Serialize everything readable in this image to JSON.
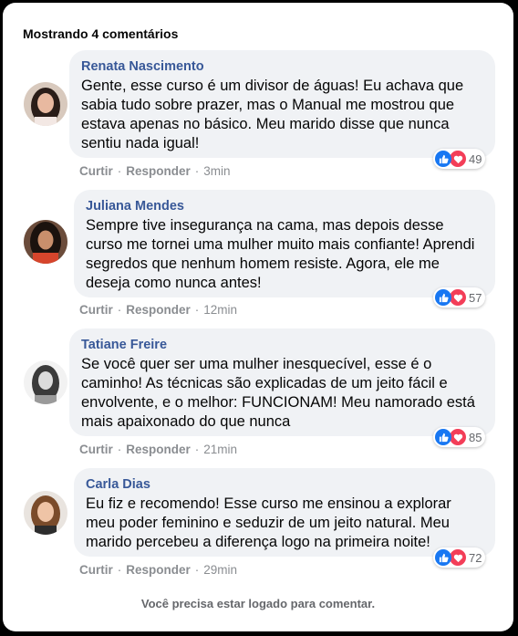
{
  "header": {
    "title": "Mostrando 4 comentários"
  },
  "comments": [
    {
      "author": "Renata Nascimento",
      "text": "Gente, esse curso é um divisor de águas! Eu achava que sabia tudo sobre prazer, mas o Manual me mostrou que estava apenas no básico. Meu marido disse que nunca sentiu nada igual!",
      "like_label": "Curtir",
      "reply_label": "Responder",
      "time": "3min",
      "reactions": "49"
    },
    {
      "author": "Juliana Mendes",
      "text": "Sempre tive insegurança na cama, mas depois desse curso me tornei uma mulher muito mais confiante! Aprendi segredos que nenhum homem resiste. Agora, ele me deseja como nunca antes!",
      "like_label": "Curtir",
      "reply_label": "Responder",
      "time": "12min",
      "reactions": "57"
    },
    {
      "author": "Tatiane Freire",
      "text": "Se você quer ser uma mulher inesquecível, esse é o caminho! As técnicas são explicadas de um jeito fácil e envolvente, e o melhor: FUNCIONAM! Meu namorado está mais apaixonado do que nunca",
      "like_label": "Curtir",
      "reply_label": "Responder",
      "time": "21min",
      "reactions": "85"
    },
    {
      "author": "Carla Dias",
      "text": "Eu fiz e recomendo! Esse curso me ensinou a explorar meu poder feminino e seduzir de um jeito natural. Meu marido percebeu a diferença logo na primeira noite!",
      "like_label": "Curtir",
      "reply_label": "Responder",
      "time": "29min",
      "reactions": "72"
    }
  ],
  "footer": {
    "text": "Você precisa estar logado para comentar."
  },
  "colors": {
    "author": "#385898",
    "bubble": "#f0f2f5",
    "like": "#1877f2",
    "love": "#f33e58"
  },
  "icons": {
    "like": "thumbs-up-icon",
    "love": "heart-icon"
  }
}
